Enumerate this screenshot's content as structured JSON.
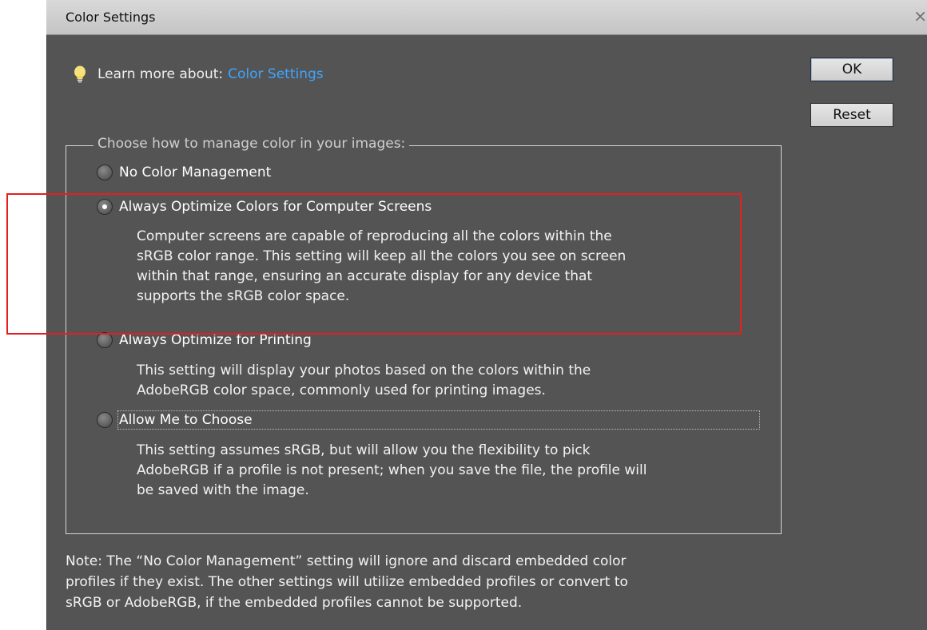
{
  "window": {
    "title": "Color Settings",
    "close_glyph": "×"
  },
  "learn": {
    "label": "Learn more about:",
    "link": "Color Settings",
    "icon": "lightbulb-icon"
  },
  "buttons": {
    "ok": "OK",
    "reset": "Reset"
  },
  "group": {
    "legend": "Choose how to manage color in your images:",
    "options": [
      {
        "label": "No Color Management",
        "checked": false,
        "description": []
      },
      {
        "label": "Always Optimize Colors for Computer Screens",
        "checked": true,
        "description": [
          "Computer screens are capable of reproducing all the colors within the",
          "sRGB color range. This setting will keep all the colors you see on screen",
          "within that range, ensuring an accurate display for any device that",
          "supports the sRGB color space."
        ]
      },
      {
        "label": "Always Optimize for Printing",
        "checked": false,
        "description": [
          "This setting will display your photos based on the colors within the",
          "AdobeRGB color space, commonly used for printing images."
        ]
      },
      {
        "label": "Allow Me to Choose",
        "checked": false,
        "description": [
          "This setting assumes sRGB, but will allow you the flexibility to pick",
          "AdobeRGB if a profile is not present; when you save the file, the profile will",
          "be saved with the image."
        ]
      }
    ]
  },
  "note": [
    "Note: The “No Color Management” setting will ignore and discard embedded color",
    "profiles if they exist. The other settings will utilize embedded profiles or convert to",
    "sRGB or AdobeRGB, if the embedded profiles cannot be supported."
  ],
  "colors": {
    "dialog_bg": "#545454",
    "link": "#3fa5ff",
    "highlight": "#e41f1f"
  }
}
